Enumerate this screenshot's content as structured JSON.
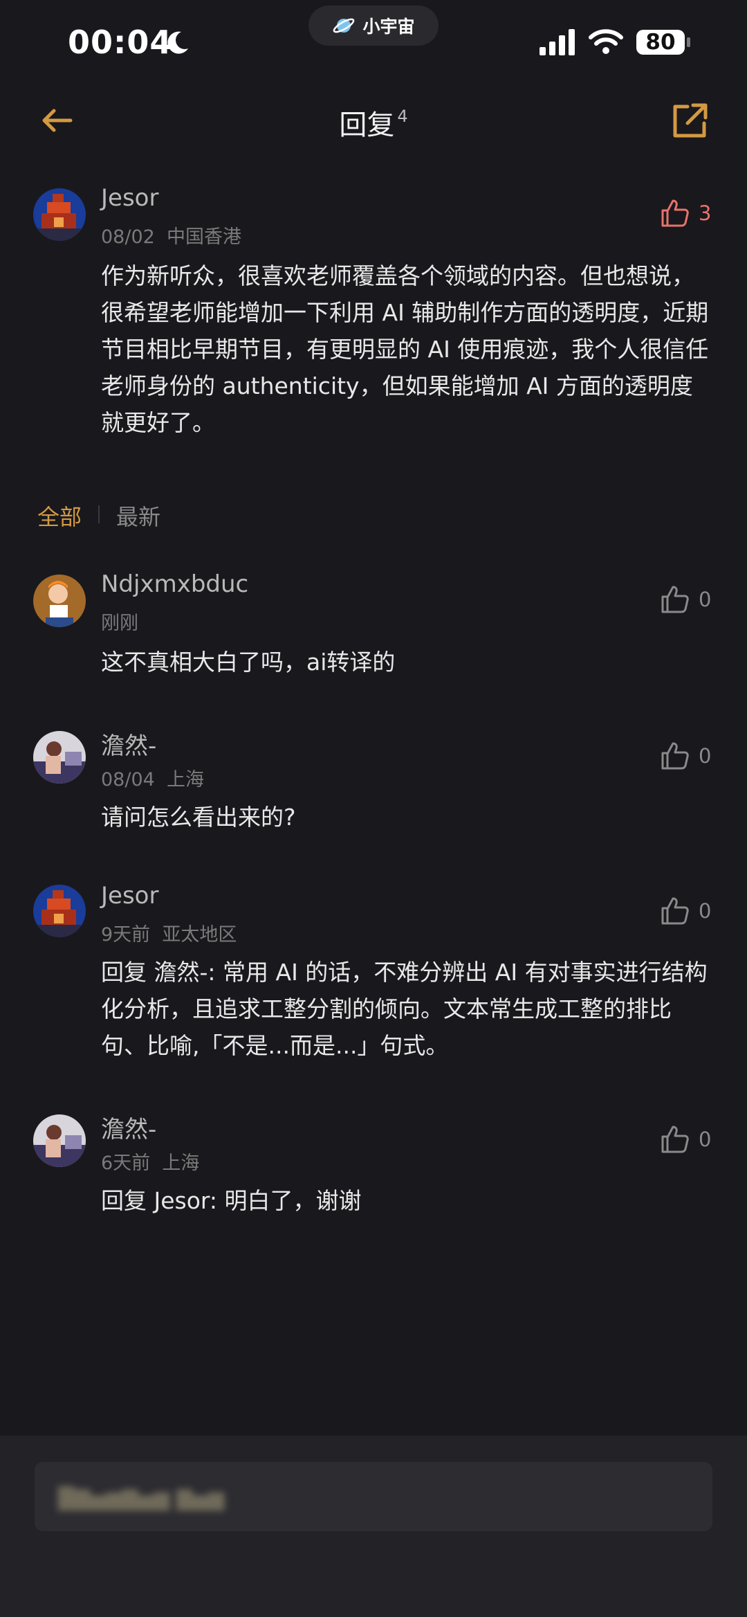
{
  "status_bar": {
    "time": "00:04",
    "app_pill": "小宇宙",
    "battery": "80"
  },
  "nav": {
    "title": "回复",
    "count": "4"
  },
  "main_comment": {
    "username": "Jesor",
    "date": "08/02",
    "location": "中国香港",
    "likes": "3",
    "text": "作为新听众，很喜欢老师覆盖各个领域的内容。但也想说，很希望老师能增加一下利用 AI 辅助制作方面的透明度，近期节目相比早期节目，有更明显的 AI 使用痕迹，我个人很信任老师身份的 authenticity，但如果能增加 AI 方面的透明度就更好了。"
  },
  "tabs": {
    "all": "全部",
    "latest": "最新"
  },
  "replies": [
    {
      "username": "Ndjxmxbduc",
      "date": "刚刚",
      "location": "",
      "likes": "0",
      "text": "这不真相大白了吗，ai转译的"
    },
    {
      "username": "澹然-",
      "date": "08/04",
      "location": "上海",
      "likes": "0",
      "text": "请问怎么看出来的?"
    },
    {
      "username": "Jesor",
      "date": "9天前",
      "location": "亚太地区",
      "likes": "0",
      "text": "回复 澹然-: 常用 AI 的话，不难分辨出 AI 有对事实进行结构化分析，且追求工整分割的倾向。文本常生成工整的排比句、比喻,「不是...而是...」句式。"
    },
    {
      "username": "澹然-",
      "date": "6天前",
      "location": "上海",
      "likes": "0",
      "text": "回复 Jesor: 明白了，谢谢"
    }
  ],
  "colors": {
    "background": "#19181d",
    "accent": "#d39a43",
    "liked": "#e8736a",
    "muted": "#7a7a7a"
  }
}
